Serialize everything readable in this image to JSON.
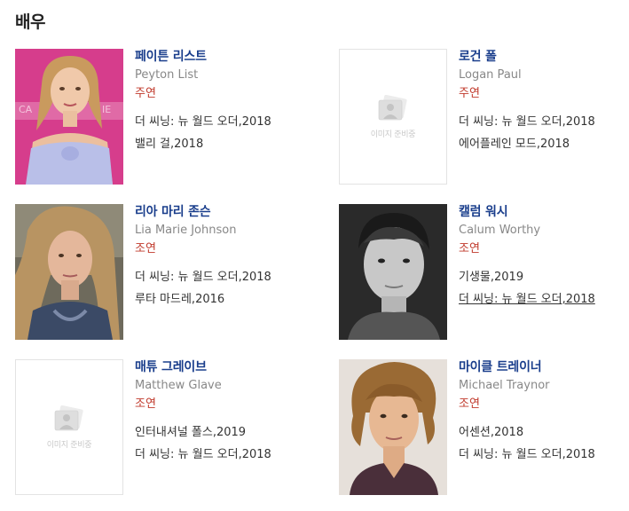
{
  "section_title": "배우",
  "placeholder_label": "이미지 준비중",
  "actors": [
    {
      "name_ko": "페이튼 리스트",
      "name_en": "Peyton List",
      "role": "주연",
      "photo": "photo",
      "works": [
        "더 씨닝: 뉴 월드 오더,2018",
        "밸리 걸,2018"
      ]
    },
    {
      "name_ko": "로건 폴",
      "name_en": "Logan Paul",
      "role": "주연",
      "photo": "placeholder",
      "works": [
        "더 씨닝: 뉴 월드 오더,2018",
        "에어플레인 모드,2018"
      ]
    },
    {
      "name_ko": "리아 마리 존슨",
      "name_en": "Lia Marie Johnson",
      "role": "조연",
      "photo": "photo",
      "works": [
        "더 씨닝: 뉴 월드 오더,2018",
        "루타 마드레,2016"
      ]
    },
    {
      "name_ko": "캘럼 워시",
      "name_en": "Calum Worthy",
      "role": "조연",
      "photo": "photo",
      "works": [
        "기생물,2019",
        "더 씨닝: 뉴 월드 오더,2018"
      ],
      "underlined_work": 1
    },
    {
      "name_ko": "매튜 그레이브",
      "name_en": "Matthew Glave",
      "role": "조연",
      "photo": "placeholder",
      "works": [
        "인터내셔널 폴스,2019",
        "더 씨닝: 뉴 월드 오더,2018"
      ]
    },
    {
      "name_ko": "마이클 트레이너",
      "name_en": "Michael Traynor",
      "role": "조연",
      "photo": "photo",
      "works": [
        "어센션,2018",
        "더 씨닝: 뉴 월드 오더,2018"
      ]
    }
  ],
  "colors": {
    "name": "#1a3e8c",
    "role": "#c0392b",
    "english_name": "#888888"
  }
}
